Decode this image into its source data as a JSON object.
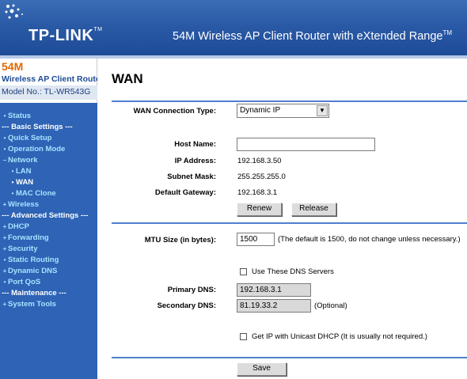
{
  "header": {
    "logo": "TP-LINK",
    "logo_mark": "TM",
    "tagline": "54M Wireless AP Client Router with eXtended Range",
    "tagline_mark": "TM"
  },
  "brand": {
    "line1": "54M",
    "line2": "Wireless AP Client Router",
    "model": "Model No.: TL-WR543G"
  },
  "nav": [
    {
      "label": "Status",
      "bullet": "•",
      "style": "blue"
    },
    {
      "label": "--- Basic Settings ---",
      "bullet": "",
      "style": "white"
    },
    {
      "label": "Quick Setup",
      "bullet": "•",
      "style": "blue"
    },
    {
      "label": "Operation Mode",
      "bullet": "•",
      "style": "blue"
    },
    {
      "label": "Network",
      "bullet": "–",
      "style": "blue"
    },
    {
      "label": "LAN",
      "bullet": "•",
      "style": "blue",
      "sub": true
    },
    {
      "label": "WAN",
      "bullet": "•",
      "style": "white",
      "sub": true
    },
    {
      "label": "MAC Clone",
      "bullet": "•",
      "style": "blue",
      "sub": true
    },
    {
      "label": "Wireless",
      "bullet": "+",
      "style": "blue"
    },
    {
      "label": "--- Advanced Settings ---",
      "bullet": "",
      "style": "white"
    },
    {
      "label": "DHCP",
      "bullet": "+",
      "style": "blue"
    },
    {
      "label": "Forwarding",
      "bullet": "+",
      "style": "blue"
    },
    {
      "label": "Security",
      "bullet": "+",
      "style": "blue"
    },
    {
      "label": "Static Routing",
      "bullet": "•",
      "style": "blue"
    },
    {
      "label": "Dynamic DNS",
      "bullet": "+",
      "style": "blue"
    },
    {
      "label": "Port QoS",
      "bullet": "•",
      "style": "blue"
    },
    {
      "label": "--- Maintenance ---",
      "bullet": "",
      "style": "white"
    },
    {
      "label": "System Tools",
      "bullet": "+",
      "style": "blue"
    }
  ],
  "page": {
    "title": "WAN",
    "wan_type_label": "WAN Connection Type:",
    "wan_type_value": "Dynamic IP",
    "host_label": "Host Name:",
    "host_value": "",
    "ip_label": "IP Address:",
    "ip_value": "192.168.3.50",
    "mask_label": "Subnet Mask:",
    "mask_value": "255.255.255.0",
    "gw_label": "Default Gateway:",
    "gw_value": "192.168.3.1",
    "renew": "Renew",
    "release": "Release",
    "mtu_label": "MTU Size (in bytes):",
    "mtu_value": "1500",
    "mtu_note": "(The default is 1500, do not change unless necessary.)",
    "dns_check_label": "Use These DNS Servers",
    "primary_dns_label": "Primary DNS:",
    "primary_dns_value": "192.168.3.1",
    "secondary_dns_label": "Secondary DNS:",
    "secondary_dns_value": "81.19.33.2",
    "optional": "(Optional)",
    "unicast_label": "Get IP with Unicast DHCP (It is usually not required.)",
    "save": "Save"
  },
  "colors": {
    "header": "#2a5aa6",
    "sidebar": "#2e63b5",
    "nav_link": "#a8e2ff",
    "brand_orange": "#e06a00",
    "separator": "#4f7fcf"
  }
}
